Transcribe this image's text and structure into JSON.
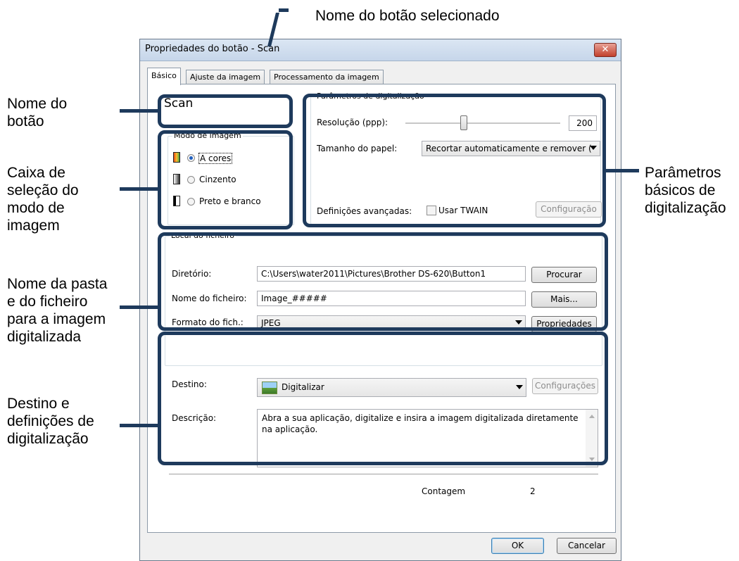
{
  "annotations": {
    "selected_button_name": "Nome do botão selecionado",
    "button_name": [
      "Nome do",
      "botão"
    ],
    "image_mode_box": [
      "Caixa de",
      "seleção do",
      "modo de",
      "imagem"
    ],
    "basic_scan_params": [
      "Parâmetros",
      "básicos de",
      "digitalização"
    ],
    "folder_file_name": [
      "Nome da pasta",
      "e do ficheiro",
      "para a imagem",
      "digitalizada"
    ],
    "destination_settings": [
      "Destino e",
      "definições de",
      "digitalização"
    ]
  },
  "window": {
    "title": "Propriedades do botão - Scan",
    "close_glyph": "✕"
  },
  "tabs": [
    "Básico",
    "Ajuste da imagem",
    "Processamento da imagem"
  ],
  "button_name_value": "Scan",
  "image_mode": {
    "label": "Modo de imagem",
    "options": [
      "A cores",
      "Cinzento",
      "Preto e branco"
    ],
    "selected": "A cores"
  },
  "scan_params": {
    "label": "Parâmetros de digitalização",
    "resolution_label": "Resolução (ppp):",
    "resolution_value": "200",
    "resolution_slider_fraction": 0.37,
    "paper_size_label": "Tamanho do papel:",
    "paper_size_value": "Recortar automaticamente e remover (",
    "advanced_label": "Definições avançadas:",
    "twain_label": "Usar TWAIN",
    "config_button": "Configuração"
  },
  "file_location": {
    "label": "Local do ficheiro",
    "directory_label": "Diretório:",
    "directory_value": "C:\\Users\\water2011\\Pictures\\Brother DS-620\\Button1",
    "browse_button": "Procurar",
    "filename_label": "Nome do ficheiro:",
    "filename_value": "Image_#####",
    "more_button": "Mais...",
    "format_label": "Formato do fich.:",
    "format_value": "JPEG",
    "properties_button": "Propriedades"
  },
  "destination": {
    "label": "Destino:",
    "value": "Digitalizar",
    "settings_button": "Configurações",
    "description_label": "Descrição:",
    "description_text": "Abra a sua aplicação, digitalize e insira a imagem digitalizada diretamente na aplicação.",
    "count_label": "Contagem",
    "count_value": "2"
  },
  "footer": {
    "ok_button": "OK",
    "cancel_button": "Cancelar"
  },
  "colors": {
    "callout": "#1e3a5c",
    "close_button": "#c2402c"
  }
}
